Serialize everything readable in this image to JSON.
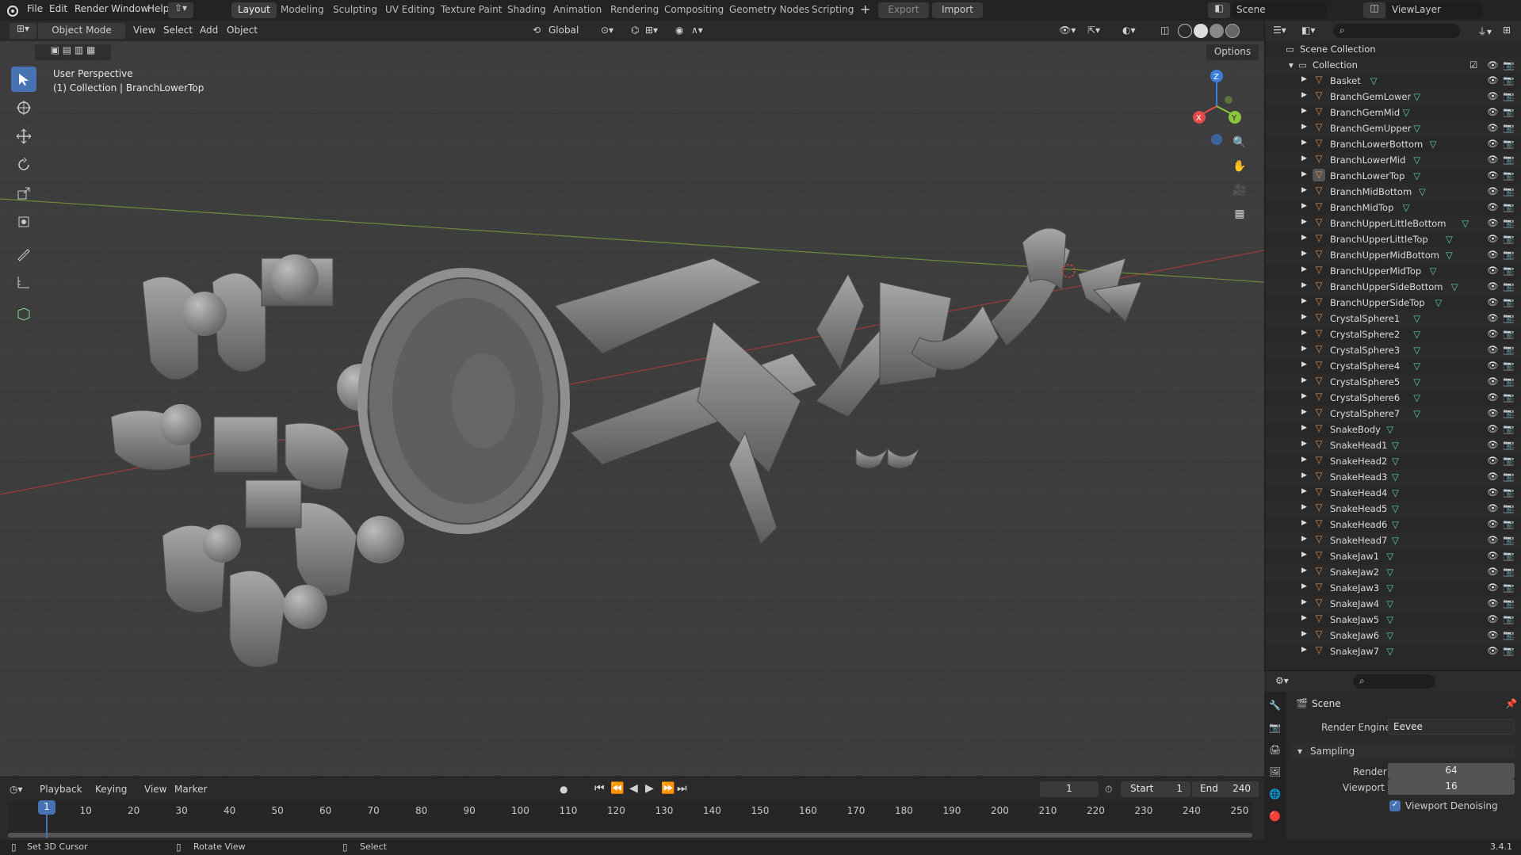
{
  "menus": {
    "file": "File",
    "edit": "Edit",
    "render": "Render",
    "window": "Window",
    "help": "Help"
  },
  "workspaces": [
    "Layout",
    "Modeling",
    "Sculpting",
    "UV Editing",
    "Texture Paint",
    "Shading",
    "Animation",
    "Rendering",
    "Compositing",
    "Geometry Nodes",
    "Scripting"
  ],
  "top_right": {
    "export": "Export",
    "import": "Import",
    "scene": "Scene",
    "view_layer": "ViewLayer"
  },
  "viewport_header": {
    "mode": "Object Mode",
    "view": "View",
    "select": "Select",
    "add": "Add",
    "object": "Object",
    "transform": "Global",
    "options": "Options"
  },
  "overlay": {
    "perspective": "User Perspective",
    "collection": "(1) Collection | BranchLowerTop"
  },
  "gizmo": {
    "x": "X",
    "y": "Y",
    "z": "Z"
  },
  "outliner": {
    "root": "Scene Collection",
    "collection": "Collection",
    "items": [
      "Basket",
      "BranchGemLower",
      "BranchGemMid",
      "BranchGemUpper",
      "BranchLowerBottom",
      "BranchLowerMid",
      "BranchLowerTop",
      "BranchMidBottom",
      "BranchMidTop",
      "BranchUpperLittleBottom",
      "BranchUpperLittleTop",
      "BranchUpperMidBottom",
      "BranchUpperMidTop",
      "BranchUpperSideBottom",
      "BranchUpperSideTop",
      "CrystalSphere1",
      "CrystalSphere2",
      "CrystalSphere3",
      "CrystalSphere4",
      "CrystalSphere5",
      "CrystalSphere6",
      "CrystalSphere7",
      "SnakeBody",
      "SnakeHead1",
      "SnakeHead2",
      "SnakeHead3",
      "SnakeHead4",
      "SnakeHead5",
      "SnakeHead6",
      "SnakeHead7",
      "SnakeJaw1",
      "SnakeJaw2",
      "SnakeJaw3",
      "SnakeJaw4",
      "SnakeJaw5",
      "SnakeJaw6",
      "SnakeJaw7"
    ],
    "selected": "BranchLowerTop"
  },
  "properties": {
    "title": "Scene",
    "render_engine_label": "Render Engine",
    "render_engine": "Eevee",
    "sampling": "Sampling",
    "render_label": "Render",
    "render_value": "64",
    "viewport_label": "Viewport",
    "viewport_value": "16",
    "denoise": "Viewport Denoising"
  },
  "timeline": {
    "playback": "Playback",
    "keying": "Keying",
    "view": "View",
    "marker": "Marker",
    "current_frame": "1",
    "start_label": "Start",
    "start": "1",
    "end_label": "End",
    "end": "240",
    "ticks": [
      "1",
      "10",
      "20",
      "30",
      "40",
      "50",
      "60",
      "70",
      "80",
      "90",
      "100",
      "110",
      "120",
      "130",
      "140",
      "150",
      "160",
      "170",
      "180",
      "190",
      "200",
      "210",
      "220",
      "230",
      "240",
      "250"
    ]
  },
  "status": {
    "left": "Set 3D Cursor",
    "mid": "Rotate View",
    "right": "Select",
    "version": "3.4.1"
  },
  "colors": {
    "accent": "#4772b3",
    "mesh_icon": "#e8924a",
    "vert_icon": "#5fd3a0",
    "axis_x": "#e54b4b",
    "axis_y": "#8cc63f",
    "axis_z": "#3b7fdc"
  }
}
